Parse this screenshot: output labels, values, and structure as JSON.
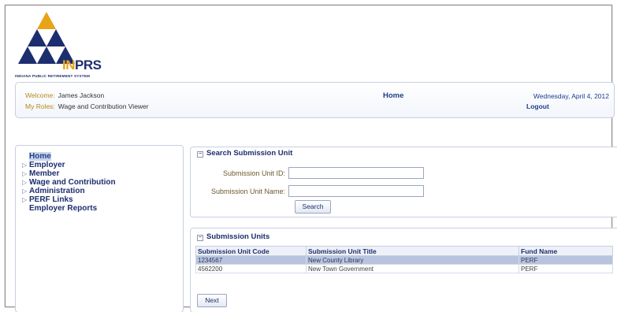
{
  "brand": {
    "logo_text_prefix": "IN",
    "logo_text_suffix": "PRS",
    "logo_subtitle": "INDIANA PUBLIC RETIREMENT SYSTEM",
    "colors": {
      "navy": "#1c2e6e",
      "gold": "#e8a317"
    }
  },
  "header": {
    "welcome_label": "Welcome:",
    "welcome_value": "James Jackson",
    "roles_label": "My Roles:",
    "roles_value": "Wage and Contribution Viewer",
    "home_link": "Home",
    "date": "Wednesday, April 4, 2012",
    "logout": "Logout"
  },
  "sidebar": {
    "items": [
      {
        "label": "Home",
        "arrow": "",
        "active": true
      },
      {
        "label": "Employer",
        "arrow": "▷"
      },
      {
        "label": "Member",
        "arrow": "▷"
      },
      {
        "label": "Wage and Contribution",
        "arrow": "▷"
      },
      {
        "label": "Administration",
        "arrow": "▷"
      },
      {
        "label": "PERF Links",
        "arrow": "▷"
      },
      {
        "label": "Employer Reports",
        "arrow": ""
      }
    ]
  },
  "search_panel": {
    "title": "Search Submission Unit",
    "collapse_glyph": "−",
    "id_label": "Submission Unit ID:",
    "id_value": "",
    "name_label": "Submission Unit Name:",
    "name_value": "",
    "search_button": "Search"
  },
  "units_panel": {
    "title": "Submission Units",
    "collapse_glyph": "−",
    "columns": [
      "Submission Unit Code",
      "Submission Unit Title",
      "Fund Name"
    ],
    "rows": [
      {
        "code": "1234567",
        "title": "New County Library",
        "fund": "PERF",
        "selected": true
      },
      {
        "code": "4562200",
        "title": "New Town Government",
        "fund": "PERF",
        "selected": false
      }
    ],
    "next_button": "Next"
  }
}
